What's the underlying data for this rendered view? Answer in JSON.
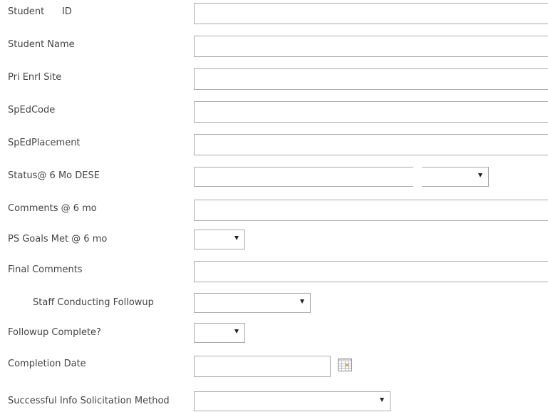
{
  "form": {
    "student_id": {
      "label": "Student      ID",
      "value": ""
    },
    "student_name": {
      "label": "Student Name",
      "value": ""
    },
    "pri_enrl_site": {
      "label": "Pri Enrl Site",
      "value": ""
    },
    "sped_code": {
      "label": "SpEdCode",
      "value": ""
    },
    "sped_placement": {
      "label": "SpEdPlacement",
      "value": ""
    },
    "status_6mo": {
      "label": "Status@ 6 Mo DESE",
      "selected": ""
    },
    "comments_6mo": {
      "label": "Comments @ 6 mo",
      "value": ""
    },
    "ps_goals_met": {
      "label": "PS Goals Met @ 6 mo",
      "selected": ""
    },
    "final_comments": {
      "label": "Final Comments",
      "value": ""
    },
    "staff_followup": {
      "label": "Staff Conducting Followup",
      "selected": ""
    },
    "followup_complete": {
      "label": "Followup Complete?",
      "selected": ""
    },
    "completion_date": {
      "label": "Completion Date",
      "value": ""
    },
    "solicitation_method": {
      "label": "Successful Info Solicitation Method",
      "selected": ""
    }
  },
  "icons": {
    "date_picker": "calendar-icon",
    "dropdown": "chevron-down-icon"
  }
}
